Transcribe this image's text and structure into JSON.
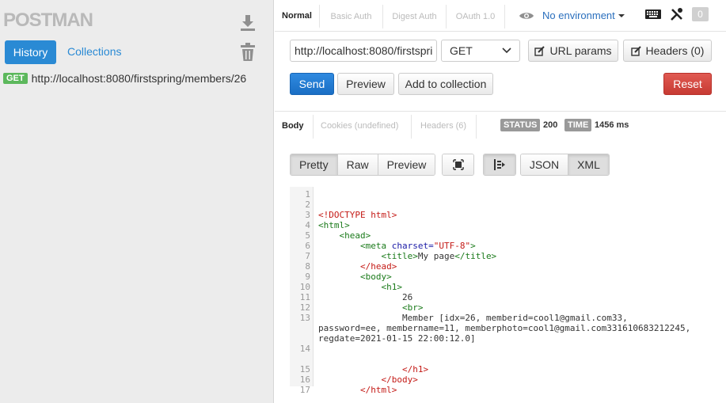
{
  "sidebar": {
    "logo": "POSTMAN",
    "tabs": {
      "history": "History",
      "collections": "Collections"
    },
    "history_items": [
      {
        "method": "GET",
        "url": "http://localhost:8080/firstspring/members/26"
      }
    ],
    "icons": [
      "download-icon",
      "trash-icon"
    ]
  },
  "auth_tabs": [
    "Normal",
    "Basic Auth",
    "Digest Auth",
    "OAuth 1.0"
  ],
  "environment": {
    "label": "No environment"
  },
  "toolbar": {
    "notif_count": "0"
  },
  "request": {
    "url": "http://localhost:8080/firstspring/members/26",
    "method": "GET",
    "url_params_label": "URL params",
    "headers_label": "Headers (0)",
    "send_label": "Send",
    "preview_label": "Preview",
    "add_collection_label": "Add to collection",
    "reset_label": "Reset"
  },
  "response": {
    "tabs": {
      "body": "Body",
      "cookies": "Cookies (undefined)",
      "headers": "Headers (6)"
    },
    "status_label": "STATUS",
    "status_value": "200",
    "time_label": "TIME",
    "time_value": "1456 ms",
    "view_modes": [
      "Pretty",
      "Raw",
      "Preview"
    ],
    "formats": [
      "JSON",
      "XML"
    ],
    "active_view": "Pretty",
    "active_format": "XML"
  },
  "code": {
    "line_numbers": [
      "1",
      "2",
      "3",
      "4",
      "5",
      "6",
      "7",
      "8",
      "9",
      "10",
      "11",
      "12",
      "13",
      "14",
      "15",
      "16",
      "17"
    ],
    "lines": [
      [],
      [],
      [
        {
          "c": "red",
          "t": "<!DOCTYPE html>"
        }
      ],
      [
        {
          "c": "green",
          "t": "<html>"
        }
      ],
      [
        {
          "c": "text",
          "t": "    "
        },
        {
          "c": "green",
          "t": "<head>"
        }
      ],
      [
        {
          "c": "text",
          "t": "        "
        },
        {
          "c": "green",
          "t": "<meta "
        },
        {
          "c": "attr",
          "t": "charset="
        },
        {
          "c": "str",
          "t": "\"UTF-8\""
        },
        {
          "c": "green",
          "t": ">"
        }
      ],
      [
        {
          "c": "text",
          "t": "            "
        },
        {
          "c": "green",
          "t": "<title>"
        },
        {
          "c": "text",
          "t": "My page"
        },
        {
          "c": "green",
          "t": "</title>"
        }
      ],
      [
        {
          "c": "text",
          "t": "        "
        },
        {
          "c": "red",
          "t": "</head>"
        }
      ],
      [
        {
          "c": "text",
          "t": "        "
        },
        {
          "c": "green",
          "t": "<body>"
        }
      ],
      [
        {
          "c": "text",
          "t": "            "
        },
        {
          "c": "green",
          "t": "<h1>"
        }
      ],
      [
        {
          "c": "text",
          "t": "                26"
        }
      ],
      [
        {
          "c": "text",
          "t": "                "
        },
        {
          "c": "green",
          "t": "<br>"
        }
      ],
      [
        {
          "c": "text",
          "t": "                Member [idx=26, memberid=cool1@gmail.com33,"
        }
      ],
      [
        {
          "c": "text",
          "t": "password=ee, membername=11, memberphoto=cool1@gmail.com331610683212245,"
        }
      ],
      [
        {
          "c": "text",
          "t": "regdate=2021-01-15 22:00:12.0]"
        }
      ],
      [],
      [],
      [
        {
          "c": "text",
          "t": "                "
        },
        {
          "c": "red",
          "t": "</h1>"
        }
      ],
      [
        {
          "c": "text",
          "t": "            "
        },
        {
          "c": "red",
          "t": "</body>"
        }
      ],
      [
        {
          "c": "text",
          "t": "        "
        },
        {
          "c": "red",
          "t": "</html>"
        }
      ]
    ]
  }
}
